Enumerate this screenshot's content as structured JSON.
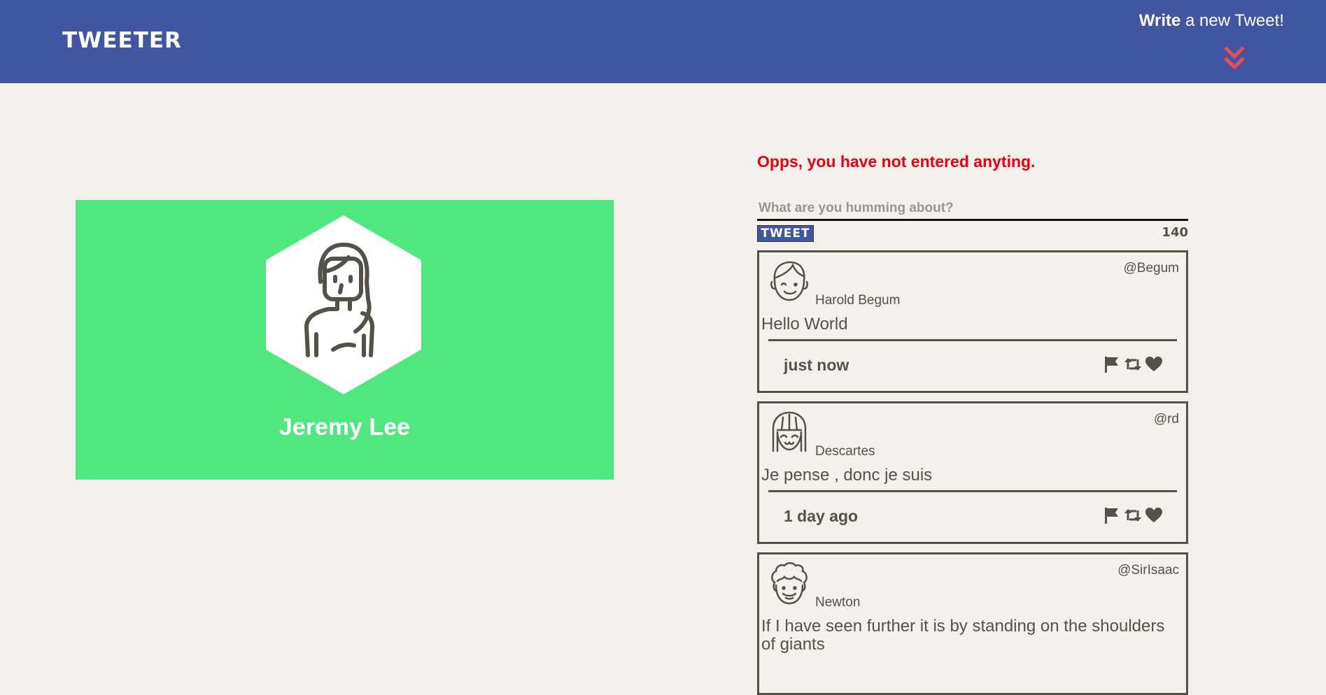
{
  "nav": {
    "brand": "TWEETER",
    "compose_bold": "Write",
    "compose_rest": " a new Tweet!",
    "compose_icon": "double-chevron-down-icon",
    "colors": {
      "nav_bg": "#4056a1",
      "chevron": "#e64f4f"
    }
  },
  "profile": {
    "name": "Jeremy Lee",
    "avatar_icon": "woman-avatar-icon",
    "colors": {
      "card_bg": "#50e680"
    }
  },
  "composer": {
    "error": "Opps, you have not entered anyting.",
    "placeholder": "What are you humming about?",
    "value": "",
    "button_label": "TWEET",
    "counter": "140",
    "colors": {
      "error": "#e8000b"
    }
  },
  "tweets": [
    {
      "handle": "@Begum",
      "name": "Harold Begum",
      "content": "Hello World",
      "time": "just now",
      "avatar_icon": "smiling-man-avatar-icon"
    },
    {
      "handle": "@rd",
      "name": "Descartes",
      "content": "Je pense , donc je suis",
      "time": "1 day ago",
      "avatar_icon": "bob-hair-avatar-icon"
    },
    {
      "handle": "@SirIsaac",
      "name": "Newton",
      "content": "If I have seen further it is by standing on the shoulders of giants",
      "time": "",
      "avatar_icon": "curly-hair-avatar-icon"
    }
  ],
  "tweet_actions": [
    "flag-icon",
    "retweet-icon",
    "heart-icon"
  ]
}
